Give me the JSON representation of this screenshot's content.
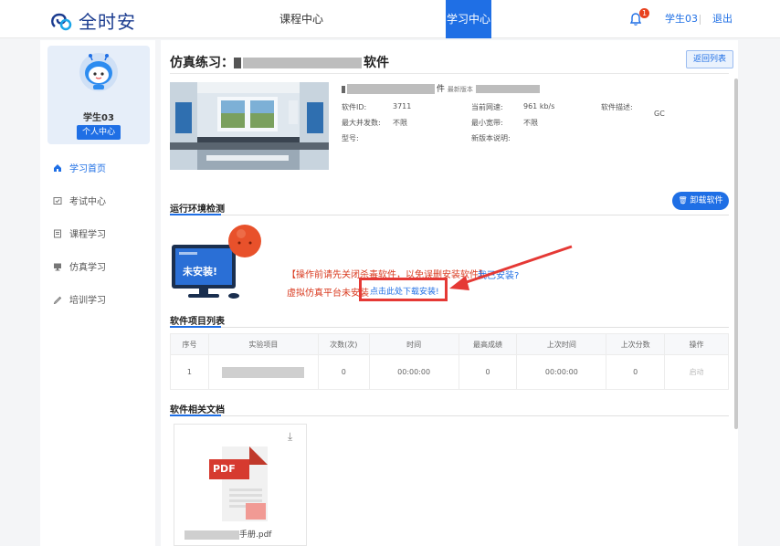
{
  "header": {
    "brand": "全时安",
    "nav": {
      "course_center": "课程中心",
      "study_center": "学习中心"
    },
    "notification_count": "1",
    "user": "学生03",
    "logout": "退出"
  },
  "sidebar": {
    "profile_name": "学生03",
    "profile_button": "个人中心",
    "items": [
      {
        "label": "学习首页",
        "icon": "home-icon",
        "active": true
      },
      {
        "label": "考试中心",
        "icon": "exam-icon",
        "active": false
      },
      {
        "label": "课程学习",
        "icon": "book-icon",
        "active": false
      },
      {
        "label": "仿真学习",
        "icon": "monitor-icon",
        "active": false
      },
      {
        "label": "培训学习",
        "icon": "pen-icon",
        "active": false
      }
    ]
  },
  "main": {
    "title_prefix": "仿真练习：",
    "title_suffix": "软件",
    "back_button": "返回列表",
    "software": {
      "name_suffix": "件",
      "latest_version_label": "最新版本",
      "id_label": "软件ID:",
      "id_value": "3711",
      "speed_label": "当前网速:",
      "speed_value": "961 kb/s",
      "desc_label": "软件描述:",
      "desc_value": "GC",
      "max_conc_label": "最大并发数:",
      "max_conc_value": "不限",
      "min_width_label": "最小宽带:",
      "min_width_value": "不限",
      "model_label": "型号:",
      "version_note_label": "新版本说明:"
    },
    "env_section": "运行环境检测",
    "uninstall_button": "卸载软件",
    "not_installed": "未安装!",
    "warn_line1": "【操作前请先关闭杀毒软件，以免误删安装软件】",
    "installed_link": "我已安装?",
    "warn_line2": "虚拟仿真平台未安装",
    "download_link": "点击此处下载安装!",
    "project_section": "软件项目列表",
    "table": {
      "headers": [
        "序号",
        "实验项目",
        "次数(次)",
        "时间",
        "最高成绩",
        "上次时间",
        "上次分数",
        "操作"
      ],
      "rows": [
        [
          "1",
          "",
          "0",
          "00:00:00",
          "0",
          "00:00:00",
          "0",
          "启动"
        ]
      ]
    },
    "doc_section": "软件相关文档",
    "doc": {
      "badge": "PDF",
      "name_suffix": "手册.pdf"
    }
  },
  "colors": {
    "accent": "#1f6fe5",
    "warn": "#d93a1f",
    "highlight_box": "#e53935"
  }
}
